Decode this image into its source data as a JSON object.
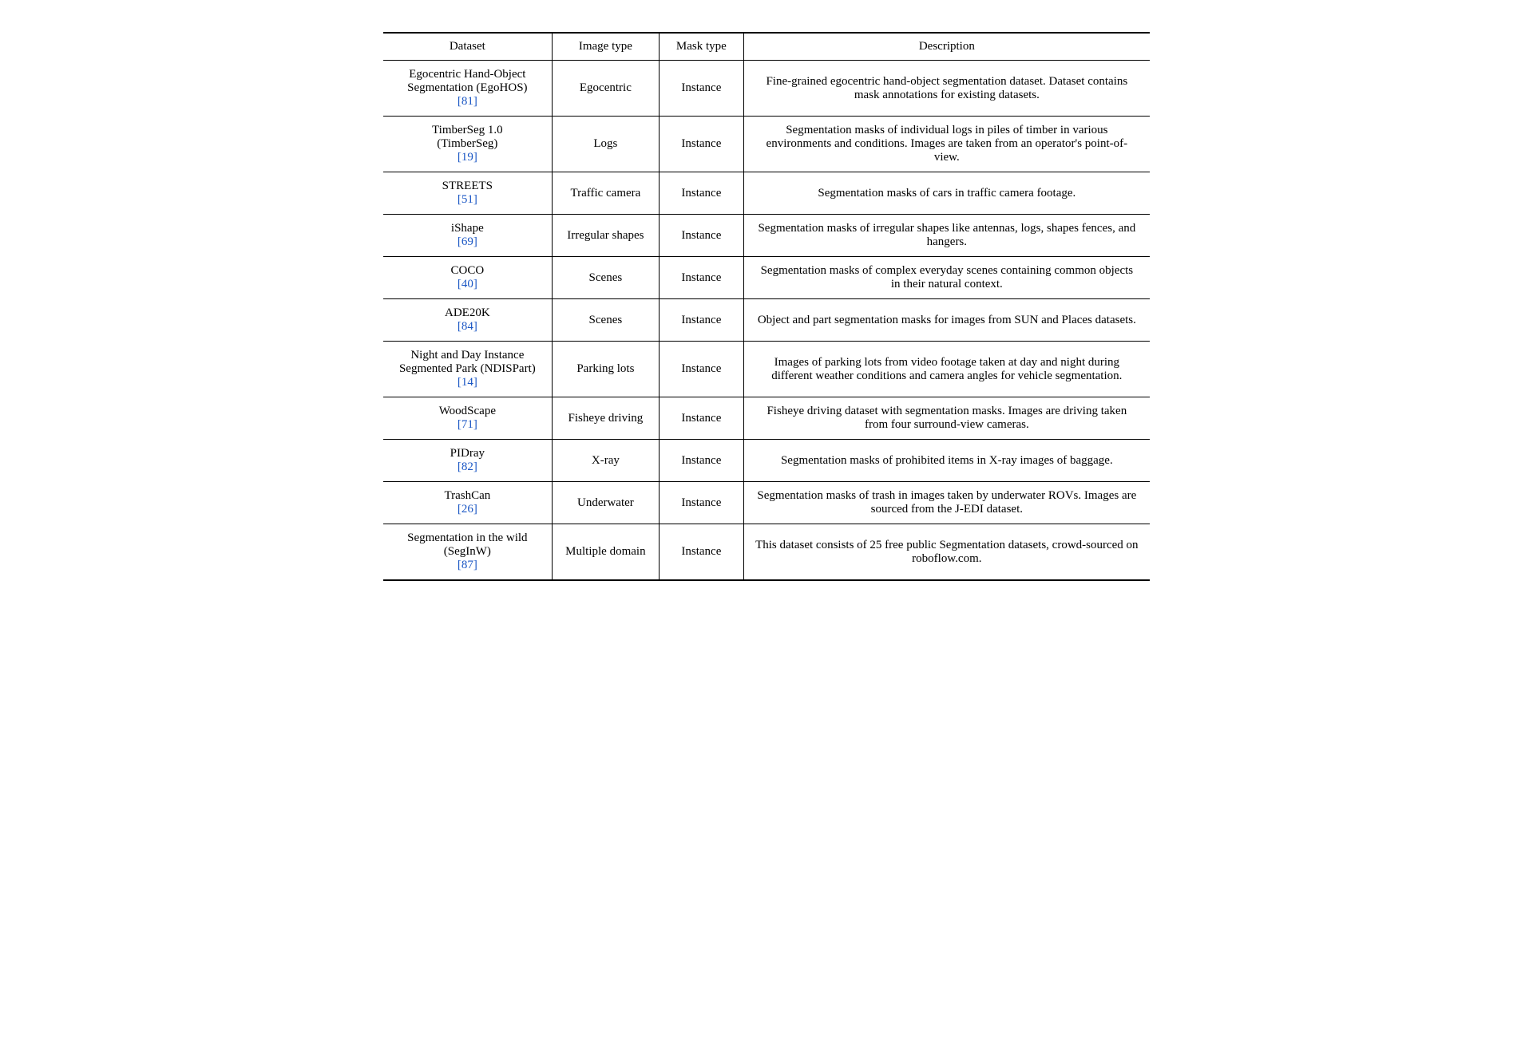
{
  "table": {
    "headers": {
      "dataset": "Dataset",
      "image_type": "Image type",
      "mask_type": "Mask type",
      "description": "Description"
    },
    "rows": [
      {
        "dataset_line1": "Egocentric Hand-Object",
        "dataset_line2": "Segmentation (EgoHOS)",
        "dataset_ref": "[81]",
        "image_type": "Egocentric",
        "mask_type": "Instance",
        "description": "Fine-grained egocentric hand-object segmentation dataset. Dataset contains mask annotations for existing datasets."
      },
      {
        "dataset_line1": "TimberSeg 1.0",
        "dataset_line2": "(TimberSeg)",
        "dataset_ref": "[19]",
        "image_type": "Logs",
        "mask_type": "Instance",
        "description": "Segmentation masks of individual logs in piles of timber in various environments and conditions. Images are taken from an operator's point-of-view."
      },
      {
        "dataset_line1": "STREETS",
        "dataset_line2": "",
        "dataset_ref": "[51]",
        "image_type": "Traffic camera",
        "mask_type": "Instance",
        "description": "Segmentation masks of cars in traffic camera footage."
      },
      {
        "dataset_line1": "iShape",
        "dataset_line2": "",
        "dataset_ref": "[69]",
        "image_type": "Irregular shapes",
        "mask_type": "Instance",
        "description": "Segmentation masks of irregular shapes like antennas, logs, shapes fences, and hangers."
      },
      {
        "dataset_line1": "COCO",
        "dataset_line2": "",
        "dataset_ref": "[40]",
        "image_type": "Scenes",
        "mask_type": "Instance",
        "description": "Segmentation masks of complex everyday scenes containing common objects in their natural context."
      },
      {
        "dataset_line1": "ADE20K",
        "dataset_line2": "",
        "dataset_ref": "[84]",
        "image_type": "Scenes",
        "mask_type": "Instance",
        "description": "Object and part segmentation masks for images from SUN and Places datasets."
      },
      {
        "dataset_line1": "Night and Day Instance",
        "dataset_line2": "Segmented Park (NDISPart)",
        "dataset_ref": "[14]",
        "image_type": "Parking lots",
        "mask_type": "Instance",
        "description": "Images of parking lots from video footage taken at day and night during different weather conditions and camera angles for vehicle segmentation."
      },
      {
        "dataset_line1": "WoodScape",
        "dataset_line2": "",
        "dataset_ref": "[71]",
        "image_type": "Fisheye driving",
        "mask_type": "Instance",
        "description": "Fisheye driving dataset with segmentation masks. Images are driving taken from four surround-view cameras."
      },
      {
        "dataset_line1": "PIDray",
        "dataset_line2": "",
        "dataset_ref": "[82]",
        "image_type": "X-ray",
        "mask_type": "Instance",
        "description": "Segmentation masks of prohibited items in X-ray images of baggage."
      },
      {
        "dataset_line1": "TrashCan",
        "dataset_line2": "",
        "dataset_ref": "[26]",
        "image_type": "Underwater",
        "mask_type": "Instance",
        "description": "Segmentation masks of trash in images taken by underwater ROVs. Images are sourced from the J-EDI dataset."
      },
      {
        "dataset_line1": "Segmentation in the wild",
        "dataset_line2": "(SegInW)",
        "dataset_ref": "[87]",
        "image_type": "Multiple domain",
        "mask_type": "Instance",
        "description": "This dataset consists of 25 free public Segmentation datasets, crowd-sourced on roboflow.com."
      }
    ]
  }
}
